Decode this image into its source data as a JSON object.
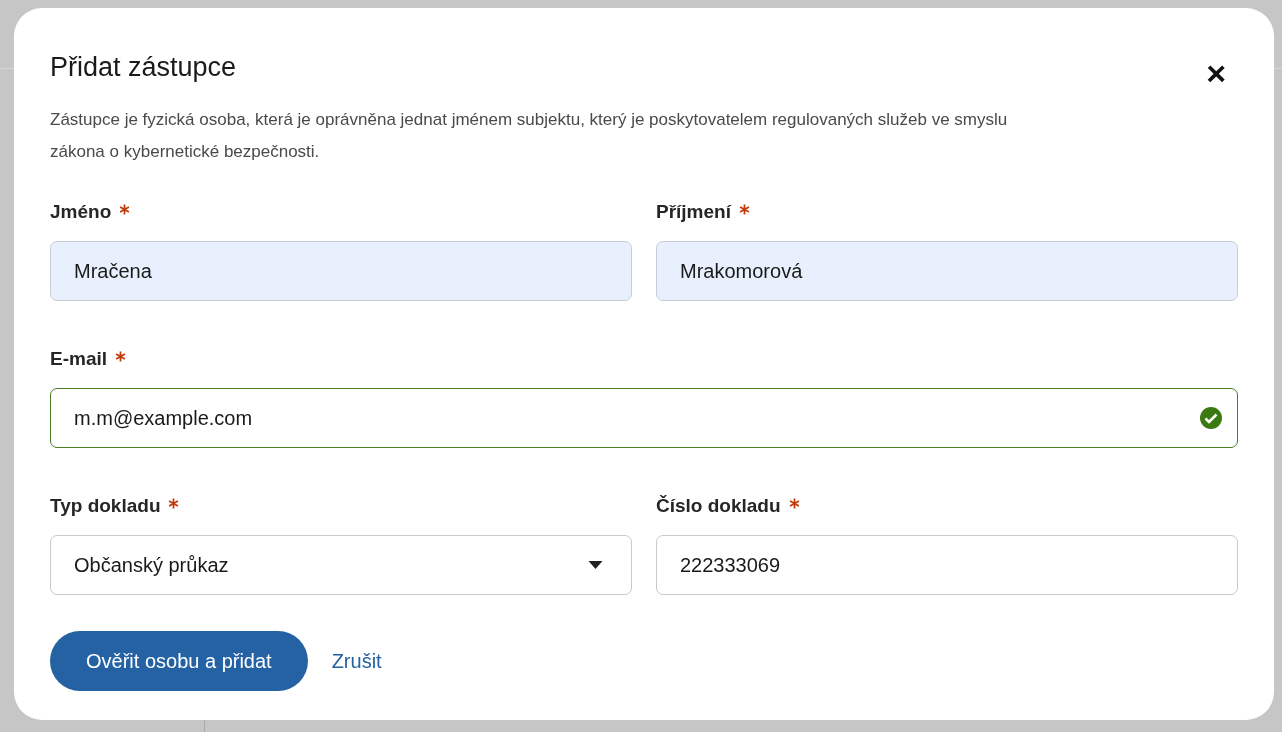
{
  "dialog": {
    "title": "Přidat zástupce",
    "close": "×",
    "description": "Zástupce je fyzická osoba, která je oprávněna jednat jménem subjektu, který je poskytovatelem regulovaných služeb ve smyslu zákona o kybernetické bezpečnosti.",
    "rows": [
      [
        {
          "kind": "text",
          "label": "Jméno",
          "required": true,
          "value": "Mračena",
          "autofilled": true
        },
        {
          "kind": "text",
          "label": "Příjmení",
          "required": true,
          "value": "Mrakomorová",
          "autofilled": true
        }
      ],
      [
        {
          "kind": "text",
          "label": "E-mail",
          "required": true,
          "value": "m.m@example.com",
          "valid": true
        }
      ],
      [
        {
          "kind": "select",
          "label": "Typ dokladu",
          "required": true,
          "value": "Občanský průkaz"
        },
        {
          "kind": "text",
          "label": "Číslo dokladu",
          "required": true,
          "value": "222333069"
        }
      ]
    ],
    "primary_button": "Ověřit osobu a přidat",
    "cancel_link": "Zrušit"
  }
}
